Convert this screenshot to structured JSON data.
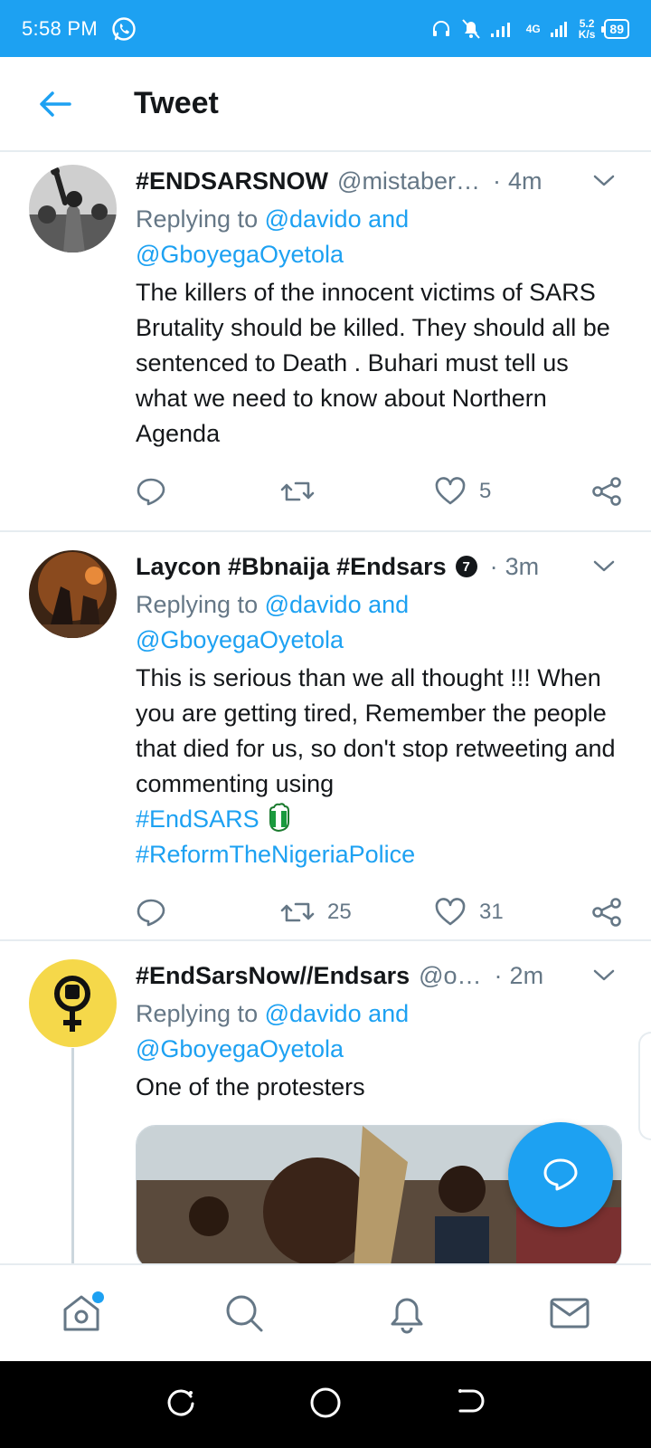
{
  "status_bar": {
    "time": "5:58 PM",
    "network_type": "4G",
    "speed_value": "5.2",
    "speed_unit": "K/s",
    "battery": "89"
  },
  "header": {
    "title": "Tweet"
  },
  "tweets": [
    {
      "name": "#ENDSARSNOW",
      "handle": "@mistaber…",
      "separator": "·",
      "age": "4m",
      "replying_prefix": "Replying to",
      "reply_user1": "@davido",
      "reply_and": "and",
      "reply_user2": "@GboyegaOyetola",
      "text": "The killers of the innocent victims of SARS Brutality should be killed. They should all be sentenced to Death . Buhari must tell us what we need to know about Northern Agenda",
      "retweets": "",
      "likes": "5"
    },
    {
      "name": "Laycon #Bbnaija #Endsars",
      "badge": "7",
      "separator": "·",
      "age": "3m",
      "replying_prefix": "Replying to",
      "reply_user1": "@davido",
      "reply_and": "and",
      "reply_user2": "@GboyegaOyetola",
      "text": "This is serious than we all thought !!! When you are getting tired, Remember the people that died for us, so don't stop retweeting and commenting using",
      "hashtag1": "#EndSARS",
      "hashtag2": "#ReformTheNigeriaPolice",
      "retweets": "25",
      "likes": "31"
    },
    {
      "name": "#EndSarsNow//Endsars",
      "handle": "@o…",
      "separator": "·",
      "age": "2m",
      "replying_prefix": "Replying to",
      "reply_user1": "@davido",
      "reply_and": "and",
      "reply_user2": "@GboyegaOyetola",
      "text": "One of the protesters"
    }
  ],
  "colors": {
    "brand": "#1da1f2",
    "text": "#14171a",
    "muted": "#657786",
    "divider": "#e6ecf0"
  },
  "icons": {
    "back": "arrow-left-icon",
    "reply": "reply-bubble-icon",
    "retweet": "retweet-icon",
    "like": "heart-icon",
    "share": "share-icon",
    "compose": "compose-reply-icon",
    "home": "home-icon",
    "search": "search-icon",
    "notifications": "bell-icon",
    "messages": "mail-icon"
  }
}
